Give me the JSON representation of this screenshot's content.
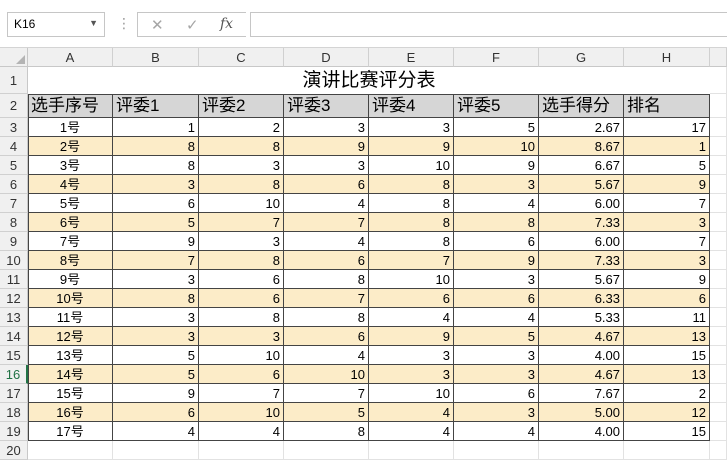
{
  "formula_bar": {
    "name_box": "K16",
    "cancel_icon": "✕",
    "enter_icon": "✓",
    "fx_label": "fx",
    "formula": ""
  },
  "columns": [
    "A",
    "B",
    "C",
    "D",
    "E",
    "F",
    "G",
    "H"
  ],
  "rows": [
    "1",
    "2",
    "3",
    "4",
    "5",
    "6",
    "7",
    "8",
    "9",
    "10",
    "11",
    "12",
    "13",
    "14",
    "15",
    "16",
    "17",
    "18",
    "19",
    "20"
  ],
  "selected_row": "16",
  "title": "演讲比赛评分表",
  "headers": [
    "选手序号",
    "评委1",
    "评委2",
    "评委3",
    "评委4",
    "评委5",
    "选手得分",
    "排名"
  ],
  "data": [
    [
      "1号",
      "1",
      "2",
      "3",
      "3",
      "5",
      "2.67",
      "17"
    ],
    [
      "2号",
      "8",
      "8",
      "9",
      "9",
      "10",
      "8.67",
      "1"
    ],
    [
      "3号",
      "8",
      "3",
      "3",
      "10",
      "9",
      "6.67",
      "5"
    ],
    [
      "4号",
      "3",
      "8",
      "6",
      "8",
      "3",
      "5.67",
      "9"
    ],
    [
      "5号",
      "6",
      "10",
      "4",
      "8",
      "4",
      "6.00",
      "7"
    ],
    [
      "6号",
      "5",
      "7",
      "7",
      "8",
      "8",
      "7.33",
      "3"
    ],
    [
      "7号",
      "9",
      "3",
      "4",
      "8",
      "6",
      "6.00",
      "7"
    ],
    [
      "8号",
      "7",
      "8",
      "6",
      "7",
      "9",
      "7.33",
      "3"
    ],
    [
      "9号",
      "3",
      "6",
      "8",
      "10",
      "3",
      "5.67",
      "9"
    ],
    [
      "10号",
      "8",
      "6",
      "7",
      "6",
      "6",
      "6.33",
      "6"
    ],
    [
      "11号",
      "3",
      "8",
      "8",
      "4",
      "4",
      "5.33",
      "11"
    ],
    [
      "12号",
      "3",
      "3",
      "6",
      "9",
      "5",
      "4.67",
      "13"
    ],
    [
      "13号",
      "5",
      "10",
      "4",
      "3",
      "3",
      "4.00",
      "15"
    ],
    [
      "14号",
      "5",
      "6",
      "10",
      "3",
      "3",
      "4.67",
      "13"
    ],
    [
      "15号",
      "9",
      "7",
      "7",
      "10",
      "6",
      "7.67",
      "2"
    ],
    [
      "16号",
      "6",
      "10",
      "5",
      "4",
      "3",
      "5.00",
      "12"
    ],
    [
      "17号",
      "4",
      "4",
      "8",
      "4",
      "4",
      "4.00",
      "15"
    ]
  ],
  "colors": {
    "alt_row_fill": "#fcecc8",
    "header_fill": "#d6d6d6",
    "selected_row_header": "#217346"
  }
}
